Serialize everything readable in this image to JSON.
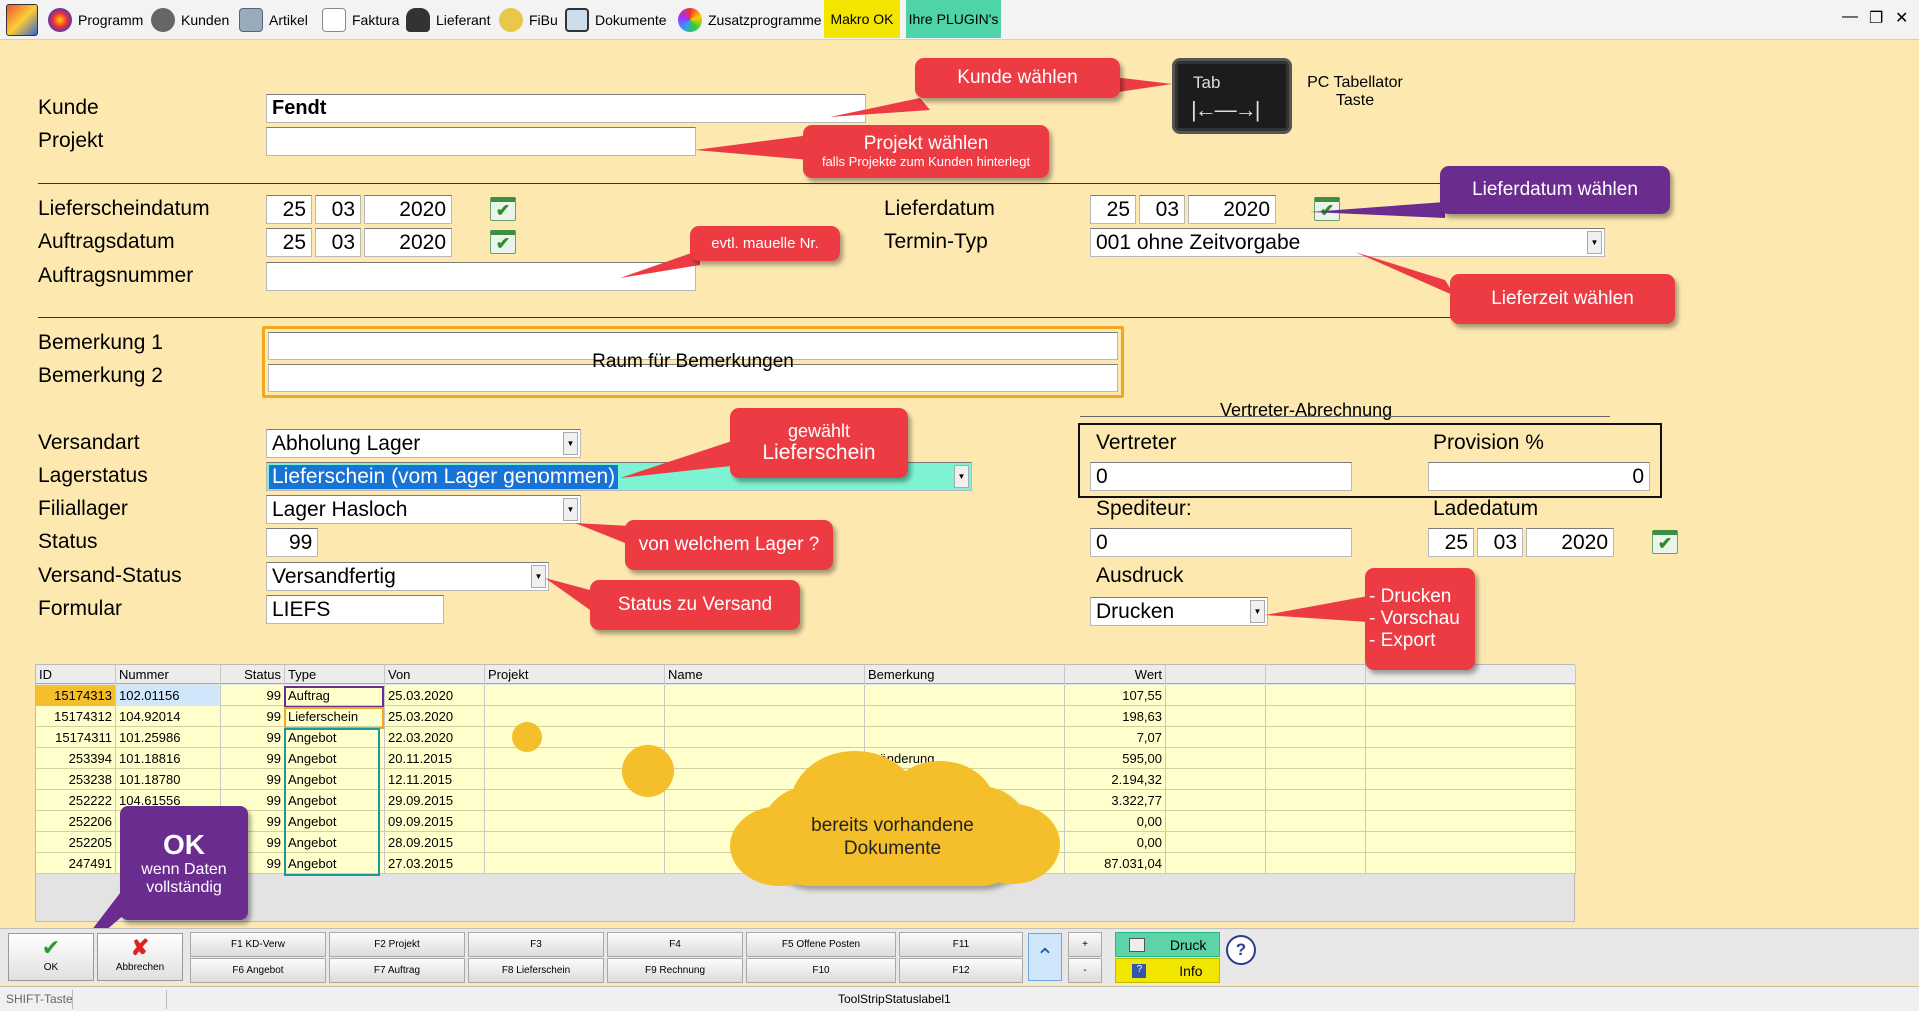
{
  "menu": {
    "items": [
      {
        "label": "Programm"
      },
      {
        "label": "Kunden"
      },
      {
        "label": "Artikel"
      },
      {
        "label": "Faktura"
      },
      {
        "label": "Lieferant"
      },
      {
        "label": "FiBu"
      },
      {
        "label": "Dokumente"
      },
      {
        "label": "Zusatzprogramme"
      }
    ],
    "makro": "Makro OK",
    "plugins": "Ihre PLUGIN's",
    "window_controls": [
      "minimize-icon",
      "restore-icon",
      "close-icon"
    ]
  },
  "form": {
    "kunde_label": "Kunde",
    "kunde_value": "Fendt",
    "projekt_label": "Projekt",
    "projekt_value": "",
    "lieferscheindatum_label": "Lieferscheindatum",
    "lieferscheindatum": {
      "d": "25",
      "m": "03",
      "y": "2020"
    },
    "auftragsdatum_label": "Auftragsdatum",
    "auftragsdatum": {
      "d": "25",
      "m": "03",
      "y": "2020"
    },
    "auftragsnummer_label": "Auftragsnummer",
    "auftragsnummer_value": "",
    "lieferdatum_label": "Lieferdatum",
    "lieferdatum": {
      "d": "25",
      "m": "03",
      "y": "2020"
    },
    "termin_typ_label": "Termin-Typ",
    "termin_typ_value": "001 ohne Zeitvorgabe",
    "bemerkung1_label": "Bemerkung 1",
    "bemerkung2_label": "Bemerkung 2",
    "bemerkung_placeholder": "Raum für Bemerkungen",
    "versandart_label": "Versandart",
    "versandart_value": "Abholung Lager",
    "lagerstatus_label": "Lagerstatus",
    "lagerstatus_value": "Lieferschein (vom Lager genommen)",
    "filiallager_label": "Filiallager",
    "filiallager_value": "Lager Hasloch",
    "status_label": "Status",
    "status_value": "99",
    "versand_status_label": "Versand-Status",
    "versand_status_value": "Versandfertig",
    "formular_label": "Formular",
    "formular_value": "LIEFS",
    "vertreter_abrechnung": "Vertreter-Abrechnung",
    "vertreter_label": "Vertreter",
    "vertreter_value": "0",
    "provision_label": "Provision %",
    "provision_value": "0",
    "spediteur_label": "Spediteur:",
    "spediteur_value": "0",
    "ladedatum_label": "Ladedatum",
    "ladedatum": {
      "d": "25",
      "m": "03",
      "y": "2020"
    },
    "ausdruck_label": "Ausdruck",
    "ausdruck_value": "Drucken"
  },
  "tab_key": {
    "key_label": "Tab",
    "caption_line1": "PC Tabellator",
    "caption_line2": "Taste"
  },
  "callouts": {
    "kunde": "Kunde wählen",
    "projekt": "Projekt  wählen",
    "projekt_sub": "falls Projekte zum Kunden hinterlegt",
    "lieferdatum": "Lieferdatum wählen",
    "nr": "evtl. mauelle Nr.",
    "lieferzeit": "Lieferzeit wählen",
    "gewaehlt1": "gewählt",
    "gewaehlt2": "Lieferschein",
    "lager": "von welchem Lager ?",
    "versand": "Status zu Versand",
    "druck1": "- Drucken",
    "druck2": "- Vorschau",
    "druck3": "- Export",
    "ok_title": "OK",
    "ok_sub1": "wenn Daten",
    "ok_sub2": "vollständig",
    "cloud1": "bereits vorhandene",
    "cloud2": "Dokumente"
  },
  "grid": {
    "columns": [
      "ID",
      "Nummer",
      "Status",
      "Type",
      "Von",
      "Projekt",
      "Name",
      "Bemerkung",
      "Wert",
      "",
      "",
      ""
    ],
    "rows": [
      [
        "15174313",
        "102.01156",
        "99",
        "Auftrag",
        "25.03.2020",
        "",
        "",
        "",
        "107,55"
      ],
      [
        "15174312",
        "104.92014",
        "99",
        "Lieferschein",
        "25.03.2020",
        "",
        "",
        "",
        "198,63"
      ],
      [
        "15174311",
        "101.25986",
        "99",
        "Angebot",
        "22.03.2020",
        "",
        "",
        "",
        "7,07"
      ],
      [
        "253394",
        "101.18816",
        "99",
        "Angebot",
        "20.11.2015",
        "",
        "",
        "eränderung",
        "595,00"
      ],
      [
        "253238",
        "101.18780",
        "99",
        "Angebot",
        "12.11.2015",
        "",
        "",
        "",
        "2.194,32"
      ],
      [
        "252222",
        "104.61556",
        "99",
        "Angebot",
        "29.09.2015",
        "",
        "",
        "",
        "3.322,77"
      ],
      [
        "252206",
        "",
        "99",
        "Angebot",
        "09.09.2015",
        "",
        "",
        "",
        "0,00"
      ],
      [
        "252205",
        "",
        "99",
        "Angebot",
        "28.09.2015",
        "",
        "",
        "",
        "0,00"
      ],
      [
        "247491",
        "",
        "99",
        "Angebot",
        "27.03.2015",
        "",
        "",
        "",
        "87.031,04"
      ]
    ]
  },
  "buttons": {
    "ok": "OK",
    "abbrechen": "Abbrechen",
    "f1": "F1 KD-Verw",
    "f6": "F6 Angebot",
    "f2": "F2 Projekt",
    "f7": "F7 Auftrag",
    "f3": "F3",
    "f8": "F8 Lieferschein",
    "f4": "F4",
    "f9": "F9 Rechnung",
    "f5": "F5 Offene Posten",
    "f10": "F10",
    "f11": "F11",
    "f12": "F12",
    "plus": "+",
    "minus": "-",
    "druck": "Druck",
    "info": "Info",
    "help": "?"
  },
  "status": {
    "left": "SHIFT-Taste",
    "center": "ToolStripStatuslabel1"
  },
  "colors": {
    "background": "#fde9b0",
    "callout_red": "#ed3b43",
    "callout_purple": "#6a2c8f",
    "highlight_teal": "#7ef3d4",
    "cloud": "#f4bf2a"
  }
}
